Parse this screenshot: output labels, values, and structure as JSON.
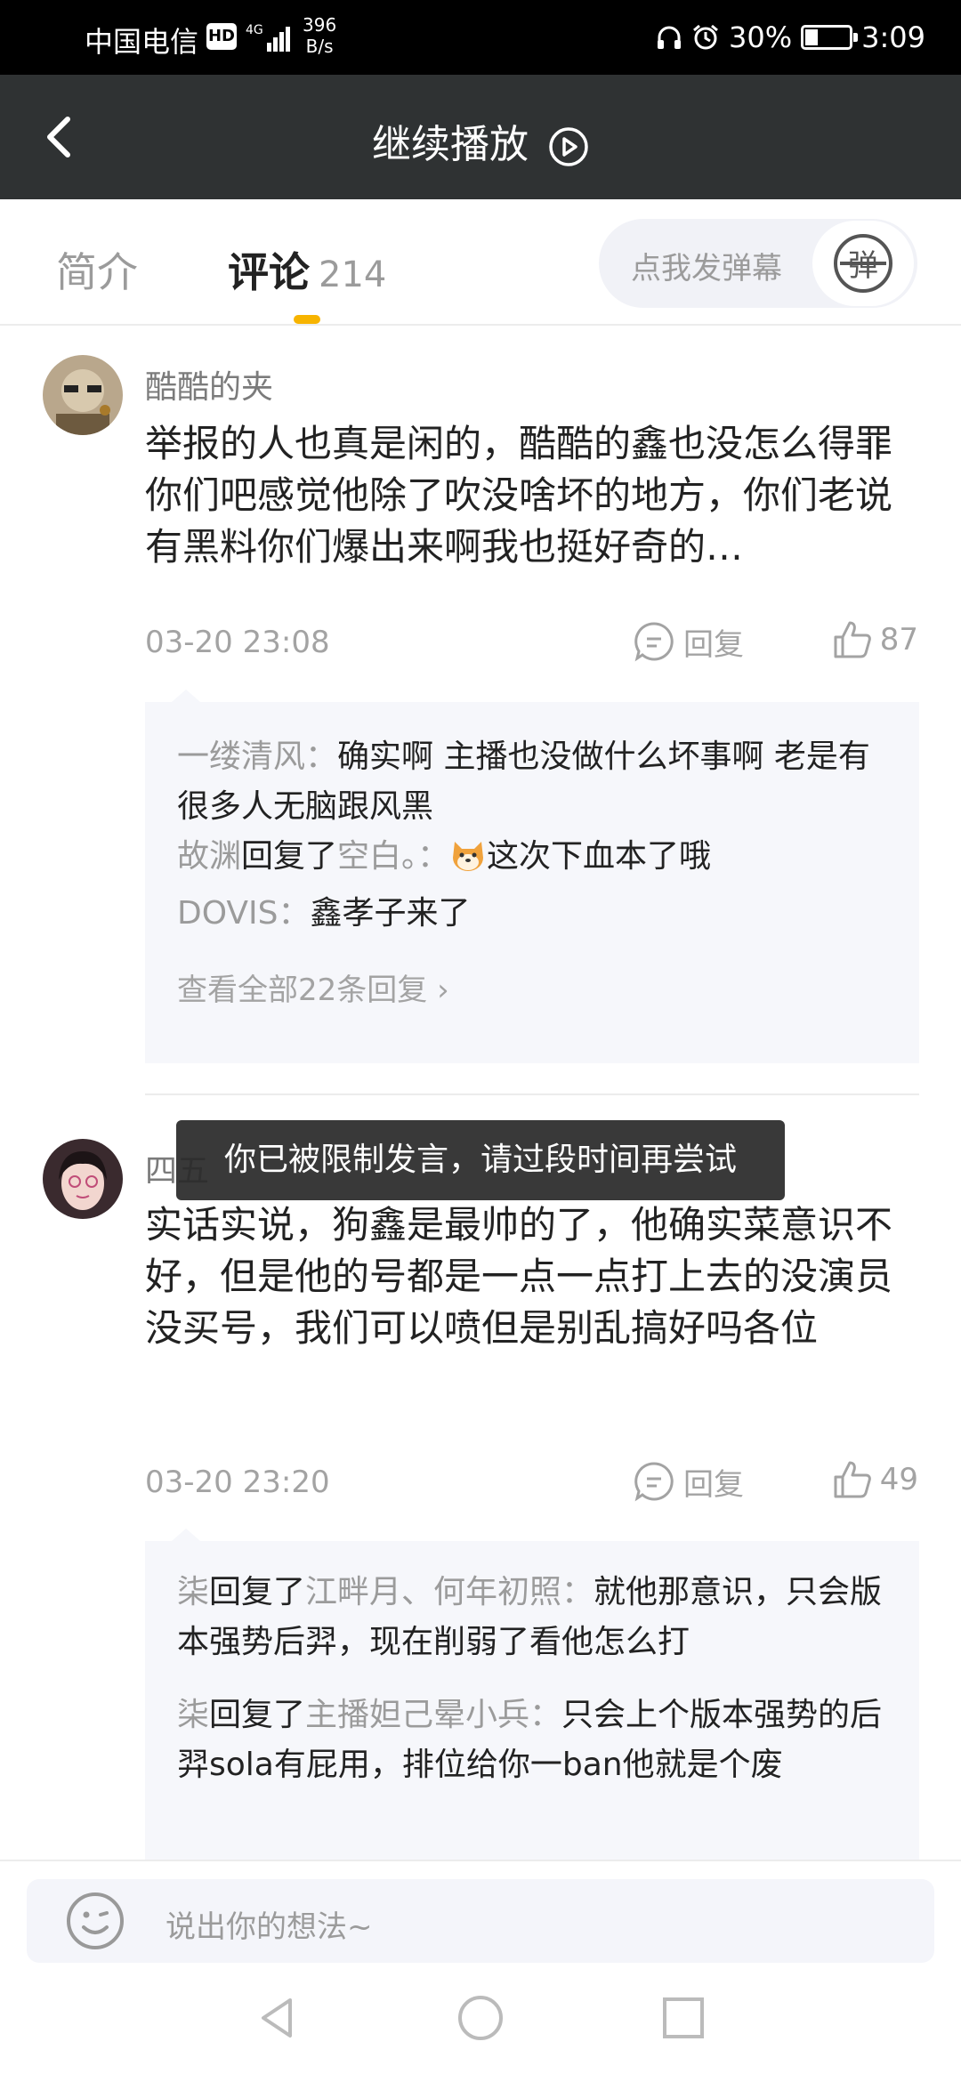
{
  "status_bar": {
    "carrier": "中国电信",
    "hd": "HD",
    "network": "4G",
    "speed_value": "396",
    "speed_unit": "B/s",
    "battery": "30%",
    "battery_level": 0.3,
    "time": "3:09"
  },
  "header": {
    "title": "继续播放"
  },
  "tabs": {
    "intro": "简介",
    "comments": "评论",
    "comments_count": "214",
    "danmaku_placeholder": "点我发弹幕",
    "danmaku_button": "弹"
  },
  "comments": [
    {
      "user": "酷酷的夹",
      "text": "举报的人也真是闲的，酷酷的鑫也没怎么得罪你们吧感觉他除了吹没啥坏的地方，你们老说有黑料你们爆出来啊我也挺好奇的…",
      "time": "03-20 23:08",
      "reply_label": "回复",
      "likes": "87",
      "sub_replies": [
        {
          "name": "一缕清风：",
          "text": "确实啊 主播也没做什么坏事啊 老是有很多人无脑跟风黑"
        },
        {
          "name": "故渊",
          "reply_word": "回复了",
          "target": "空白。：",
          "text": "这次下血本了哦"
        },
        {
          "name": "DOVIS：",
          "text": "鑫孝子来了"
        }
      ],
      "view_all": "查看全部22条回复 ›"
    },
    {
      "user": "四五",
      "text": "实话实说，狗鑫是最帅的了，他确实菜意识不好，但是他的号都是一点一点打上去的没演员没买号，我们可以喷但是别乱搞好吗各位",
      "time": "03-20 23:20",
      "reply_label": "回复",
      "likes": "49",
      "sub_replies": [
        {
          "name": "柒",
          "reply_word": "回复了",
          "target": "江畔月、何年初照：",
          "text": "就他那意识，只会版本强势后羿，现在削弱了看他怎么打"
        },
        {
          "name": "柒",
          "reply_word": "回复了",
          "target": "主播妲己晕小兵：",
          "text": "只会上个版本强势的后羿sola有屁用，排位给你一ban他就是个废"
        }
      ]
    }
  ],
  "toast": "你已被限制发言，请过段时间再尝试",
  "input": {
    "placeholder": "说出你的想法~"
  },
  "colors": {
    "accent": "#f7b400",
    "header_bg": "#2f3233",
    "sub_bg": "#f6f7fb"
  }
}
